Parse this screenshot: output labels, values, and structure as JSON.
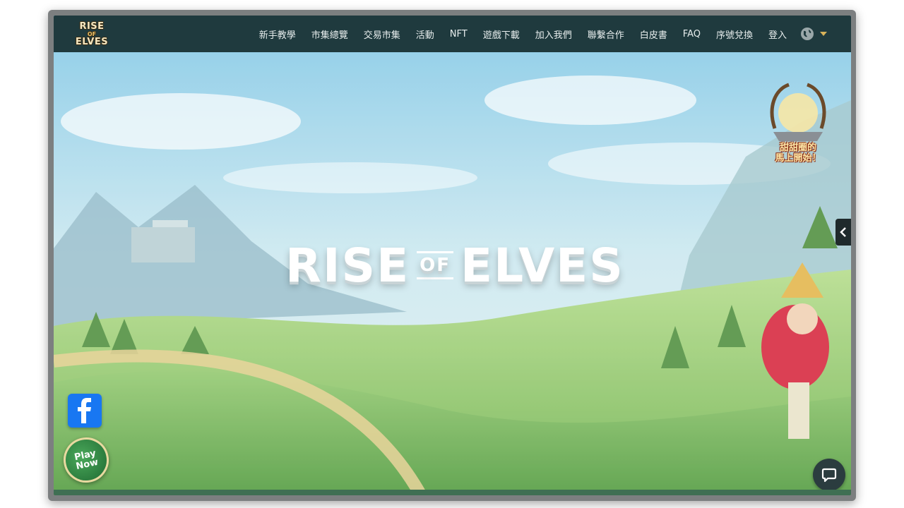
{
  "logo": {
    "line1": "RISE",
    "line2": "OF",
    "line3": "ELVES"
  },
  "nav": {
    "items": [
      "新手教學",
      "市集總覽",
      "交易市集",
      "活動",
      "NFT",
      "遊戲下載",
      "加入我們",
      "聯繫合作",
      "白皮書",
      "FAQ",
      "序號兌換",
      "登入"
    ],
    "language_icon": "globe-icon"
  },
  "hero": {
    "title_left": "RISE",
    "title_of": "OF",
    "title_right": "ELVES"
  },
  "event_badge": {
    "line1": "甜甜圈的",
    "line2": "馬上開始！"
  },
  "social": {
    "facebook_icon": "facebook-icon"
  },
  "play_now": {
    "line1": "Play",
    "line2": "Now"
  },
  "colors": {
    "navbar": "#1f3a3e",
    "accent": "#d7b25a",
    "facebook": "#1877f2"
  }
}
